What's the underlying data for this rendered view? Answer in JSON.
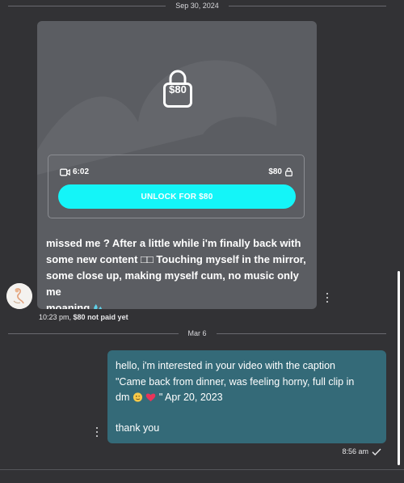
{
  "divider_top": "Sep 30, 2024",
  "divider_mid": "Mar 6",
  "locked_message": {
    "price_on_lock": "$80",
    "duration": "6:02",
    "price": "$80",
    "unlock_label": "UNLOCK FOR $80",
    "caption_lines": [
      "missed me ? After a little while i'm finally back with",
      "some new content □□ Touching myself in the mirror,",
      "some close up, making myself cum, no music only me",
      "moaning"
    ],
    "time": "10:23 pm,",
    "status": "$80 not paid yet"
  },
  "outgoing_message": {
    "lines": [
      "hello, i'm interested in your video with the caption",
      "\"Came back from dinner, was feeling horny, full clip in",
      "dm",
      "\" Apr 20, 2023"
    ],
    "closing": "thank you",
    "time": "8:56 am"
  },
  "icons": {
    "video": "video-camera-icon",
    "lock": "lock-icon",
    "more": "kebab-menu-icon",
    "check": "checkmark-icon",
    "emoji_droplets": "sweat-droplets-emoji",
    "emoji_face": "winking-face-emoji",
    "emoji_heart": "heart-emoji"
  },
  "colors": {
    "background": "#323235",
    "locked_card": "#5b5d62",
    "unlock_button": "#14f5f8",
    "outgoing_bubble": "#346a78"
  }
}
